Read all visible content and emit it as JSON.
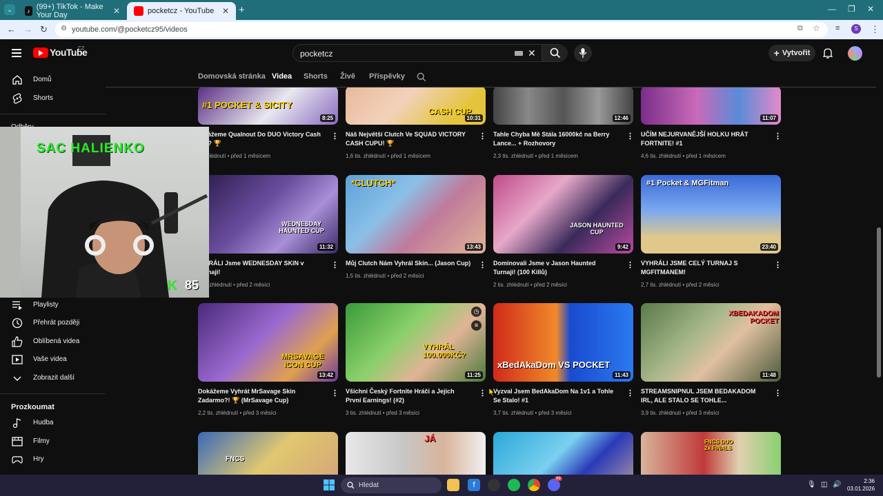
{
  "browser": {
    "tabs": [
      {
        "title": "(99+) TikTok - Make Your Day",
        "icon": "tiktok-icon"
      },
      {
        "title": "pocketcz - YouTube",
        "icon": "youtube-icon"
      }
    ],
    "url": "youtube.com/@pocketcz95/videos"
  },
  "header": {
    "logo_text": "YouTube",
    "logo_region": "CZ",
    "search_value": "pocketcz",
    "create_label": "Vytvořit"
  },
  "sidebar": {
    "items_top": [
      {
        "label": "Domů",
        "icon": "home-icon"
      },
      {
        "label": "Shorts",
        "icon": "shorts-icon"
      }
    ],
    "subs_partial": "Odběry",
    "items_you": [
      {
        "label": "Playlisty",
        "icon": "playlist-icon"
      },
      {
        "label": "Přehrát později",
        "icon": "clock-icon"
      },
      {
        "label": "Oblíbená videa",
        "icon": "thumbs-up-icon"
      },
      {
        "label": "Vaše videa",
        "icon": "video-icon"
      },
      {
        "label": "Zobrazit další",
        "icon": "chevron-down-icon"
      }
    ],
    "explore_heading": "Prozkoumat",
    "items_explore": [
      {
        "label": "Hudba",
        "icon": "music-icon"
      },
      {
        "label": "Filmy",
        "icon": "film-icon"
      },
      {
        "label": "Hry",
        "icon": "gamepad-icon"
      }
    ]
  },
  "channel_tabs": [
    "Domovská stránka",
    "Videa",
    "Shorts",
    "Živě",
    "Příspěvky"
  ],
  "active_tab": "Videa",
  "videos": [
    {
      "title": "…kážeme Qualnout Do DUO Victory Cash …u? 🏆",
      "meta": "…zhlédnutí • před 1 měsícem",
      "duration": "8:25",
      "thumb_text": "#1 POCKET & SICITY"
    },
    {
      "title": "Náš Největší Clutch Ve SQUAD VICTORY CASH CUPU! 🏆",
      "meta": "1,6 tis. zhlédnutí • před 1 měsícem",
      "duration": "10:31",
      "thumb_text": "CASH CUP"
    },
    {
      "title": "Tahle Chyba Mě Stála 16000kč na Berry Lance... + Rozhovory",
      "meta": "2,3 tis. zhlédnutí • před 1 měsícem",
      "duration": "12:46",
      "thumb_text": ""
    },
    {
      "title": "UČÍM NEJURVANĚJŠÍ HOLKU HRÁT FORTNITE! #1",
      "meta": "4,6 tis. zhlédnutí • před 1 měsícem",
      "duration": "11:07",
      "thumb_text": ""
    },
    {
      "title": "…HRÁLI Jsme WEDNESDAY SKIN v Turnaji!",
      "meta": "…s. zhlédnutí • před 2 měsíci",
      "duration": "11:32",
      "thumb_text": "WEDNESDAY HAUNTED CUP"
    },
    {
      "title": "Můj Clutch Nám Vyhrál Skin... (Jason Cup)",
      "meta": "1,5 tis. zhlédnutí • před 2 měsíci",
      "duration": "13:43",
      "thumb_text": "*CLUTCH*"
    },
    {
      "title": "Dominovali Jsme v Jason Haunted Turnaji! (100 Killů)",
      "meta": "2 tis. zhlédnutí • před 2 měsíci",
      "duration": "9:42",
      "thumb_text": "JASON HAUNTED CUP"
    },
    {
      "title": "VYHRÁLI JSME CELÝ TURNAJ S MGFITMANEM!",
      "meta": "2,7 tis. zhlédnutí • před 2 měsíci",
      "duration": "23:40",
      "thumb_text": "#1 Pocket & MGFitman"
    },
    {
      "title": "Dokážeme Vyhrát MrSavage Skin Zadarmo?! 🏆 (MrSavage Cup)",
      "meta": "2,2 tis. zhlédnutí • před 3 měsíci",
      "duration": "13:42",
      "thumb_text": "MRSAVAGE ICON CUP"
    },
    {
      "title": "Všichni Český Fortnite Hráči a Jejich První Earnings! (#2)",
      "meta": "3 tis. zhlédnutí • před 3 měsíci",
      "duration": "11:25",
      "thumb_text": "VYHRÁL 100.000KČ?"
    },
    {
      "title": "Vyzval Jsem BedAkaDom Na 1v1 a Tohle Se Stalo! #1",
      "meta": "3,7 tis. zhlédnutí • před 3 měsíci",
      "duration": "11:43",
      "thumb_text": "xBedAkaDom VS POCKET"
    },
    {
      "title": "STREAMSNIPNUL JSEM BEDAKADOM IRL, ALE STALO SE TOHLE...",
      "meta": "3,9 tis. zhlédnutí • před 3 měsíci",
      "duration": "11:48",
      "thumb_text": "XBEDAKADOM POCKET"
    },
    {
      "title": "",
      "meta": "",
      "duration": "",
      "thumb_text": "FNCS"
    },
    {
      "title": "",
      "meta": "",
      "duration": "",
      "thumb_text": "JÁ"
    },
    {
      "title": "",
      "meta": "",
      "duration": "",
      "thumb_text": ""
    },
    {
      "title": "",
      "meta": "",
      "duration": "",
      "thumb_text": "FNCS DUO 2x FINALS"
    }
  ],
  "webcam": {
    "overlay_text": "SAC HALIENKO",
    "score": "85",
    "score_prefix": "K"
  },
  "taskbar": {
    "search_label": "Hledat",
    "time": "2:36",
    "date": "03.01.2026",
    "badge": "99"
  },
  "colors": {
    "accent": "#ff0000",
    "tabbar": "#1f6e7a",
    "bg": "#0f0f0f"
  }
}
